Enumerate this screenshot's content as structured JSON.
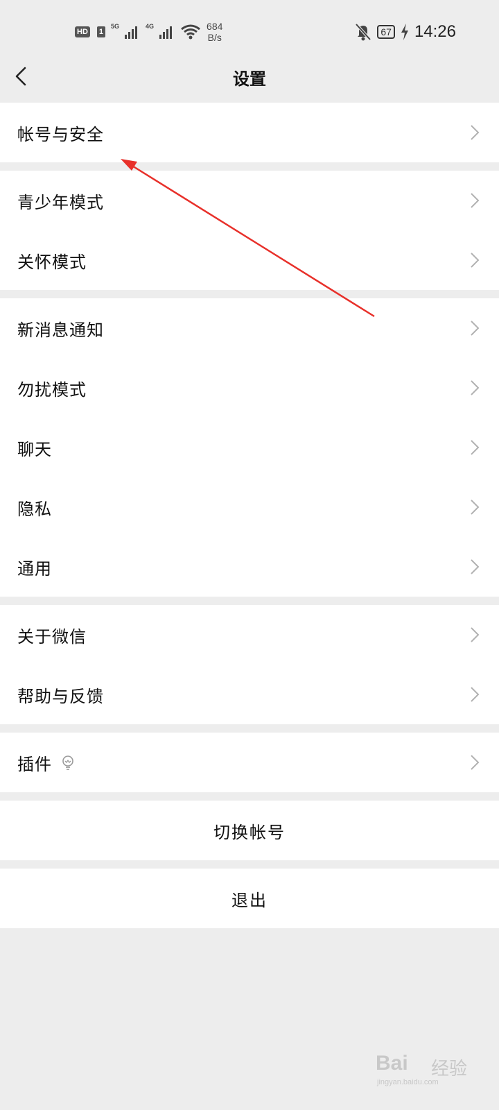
{
  "status_bar": {
    "hd": "HD",
    "sim": "1",
    "net1": "5G",
    "net2": "4G",
    "speed_value": "684",
    "speed_unit": "B/s",
    "battery": "67",
    "time": "14:26"
  },
  "nav": {
    "title": "设置"
  },
  "groups": {
    "g1": [
      "帐号与安全"
    ],
    "g2": [
      "青少年模式",
      "关怀模式"
    ],
    "g3": [
      "新消息通知",
      "勿扰模式",
      "聊天",
      "隐私",
      "通用"
    ],
    "g4": [
      "关于微信",
      "帮助与反馈"
    ],
    "g5": [
      "插件"
    ]
  },
  "actions": {
    "switch_account": "切换帐号",
    "logout": "退出"
  },
  "annotation": {
    "arrow_color": "#e8302a"
  },
  "watermark": {
    "brand": "Bai",
    "brand2": "经验",
    "url": "jingyan.baidu.com"
  }
}
